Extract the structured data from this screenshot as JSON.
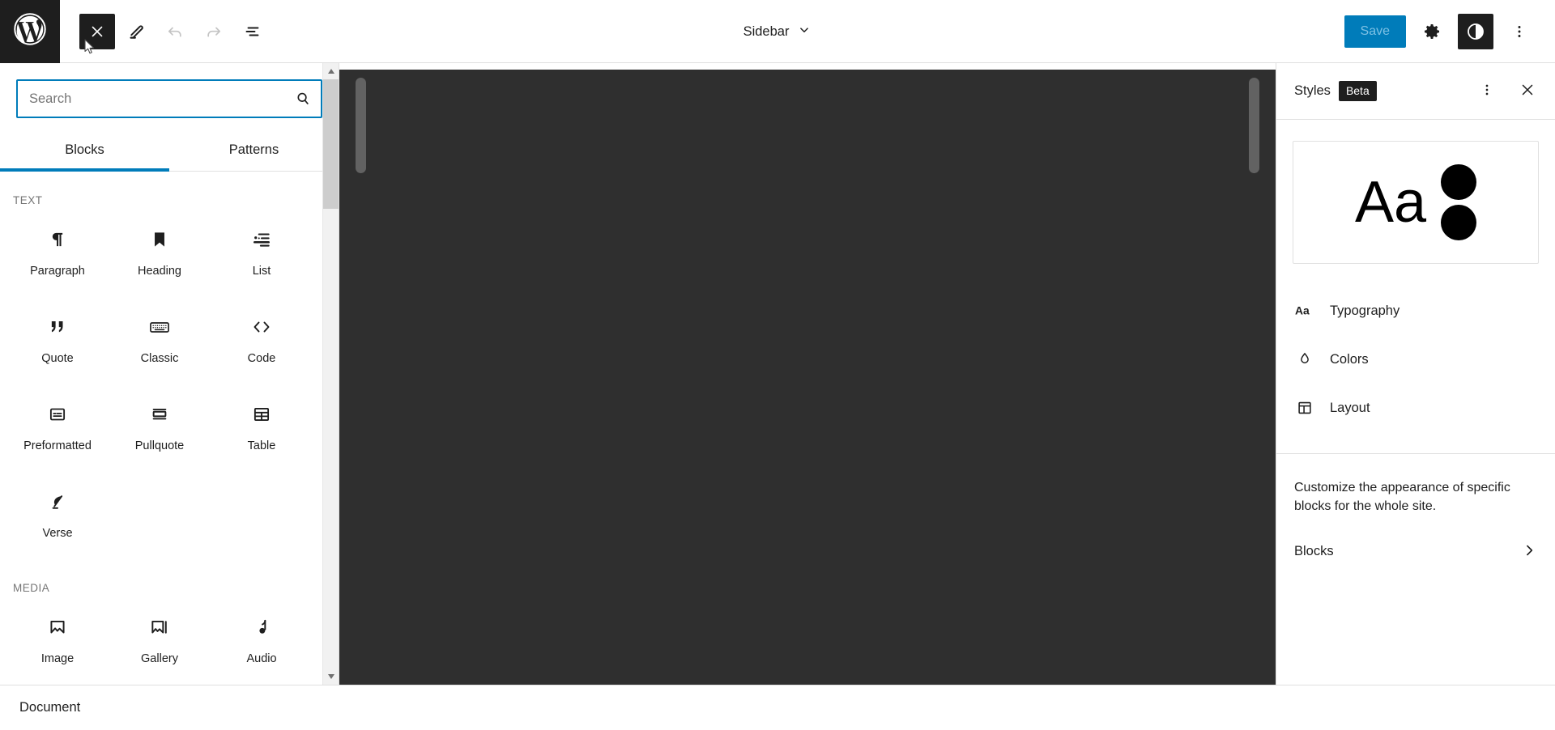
{
  "app": {
    "name": "WordPress Site Editor"
  },
  "toolbar": {
    "logo_icon": "wordpress-logo-icon",
    "buttons": [
      {
        "name": "close-inserter-button",
        "icon": "close-x-icon",
        "state": "active"
      },
      {
        "name": "edit-tool-button",
        "icon": "pencil-icon",
        "state": "default"
      },
      {
        "name": "undo-button",
        "icon": "undo-arrow-icon",
        "state": "disabled"
      },
      {
        "name": "redo-button",
        "icon": "redo-arrow-icon",
        "state": "disabled"
      },
      {
        "name": "list-view-button",
        "icon": "list-view-icon",
        "state": "default"
      }
    ],
    "document_title": "Sidebar",
    "document_title_icon": "chevron-down-icon",
    "save_label": "Save",
    "settings_icon": "gear-icon",
    "styles_icon": "contrast-half-circle-icon",
    "options_icon": "three-dots-vertical-icon",
    "accent_color": "#007cba",
    "save_text_color": "#7cc0e4"
  },
  "inserter": {
    "search": {
      "placeholder": "Search",
      "value": "",
      "icon": "search-magnifier-icon",
      "focus_color": "#007cba"
    },
    "tabs": [
      {
        "label": "Blocks",
        "active": true
      },
      {
        "label": "Patterns",
        "active": false
      }
    ],
    "categories": [
      {
        "label": "TEXT",
        "blocks": [
          {
            "label": "Paragraph",
            "icon": "pilcrow-icon"
          },
          {
            "label": "Heading",
            "icon": "bookmark-heading-icon"
          },
          {
            "label": "List",
            "icon": "bulleted-list-icon"
          },
          {
            "label": "Quote",
            "icon": "quotation-marks-icon"
          },
          {
            "label": "Classic",
            "icon": "keyboard-icon"
          },
          {
            "label": "Code",
            "icon": "angle-brackets-icon"
          },
          {
            "label": "Preformatted",
            "icon": "preformatted-box-icon"
          },
          {
            "label": "Pullquote",
            "icon": "pullquote-bars-icon"
          },
          {
            "label": "Table",
            "icon": "table-grid-icon"
          },
          {
            "label": "Verse",
            "icon": "quill-feather-icon"
          }
        ]
      },
      {
        "label": "MEDIA",
        "blocks": [
          {
            "label": "Image",
            "icon": "image-icon"
          },
          {
            "label": "Gallery",
            "icon": "gallery-icon"
          },
          {
            "label": "Audio",
            "icon": "music-note-icon"
          }
        ]
      }
    ],
    "scrollbar": {
      "up_arrow_icon": "triangle-up-icon",
      "down_arrow_icon": "triangle-down-icon"
    }
  },
  "canvas": {
    "background_color": "#2f2f2f",
    "left_scrollbar": "canvas-scrollbar-left",
    "right_scrollbar": "canvas-scrollbar-right"
  },
  "styles_sidebar": {
    "title": "Styles",
    "badge": "Beta",
    "more_icon": "three-dots-vertical-icon",
    "close_icon": "close-x-icon",
    "preview": {
      "sample_text": "Aa",
      "swatch_colors": [
        "#000000",
        "#000000"
      ]
    },
    "menu": [
      {
        "label": "Typography",
        "icon": "typography-aa-icon"
      },
      {
        "label": "Colors",
        "icon": "color-droplet-icon"
      },
      {
        "label": "Layout",
        "icon": "layout-panel-icon"
      }
    ],
    "note": "Customize the appearance of specific blocks for the whole site.",
    "blocks_row": {
      "label": "Blocks",
      "icon": "chevron-right-icon"
    }
  },
  "bottom_bar": {
    "label": "Document"
  }
}
